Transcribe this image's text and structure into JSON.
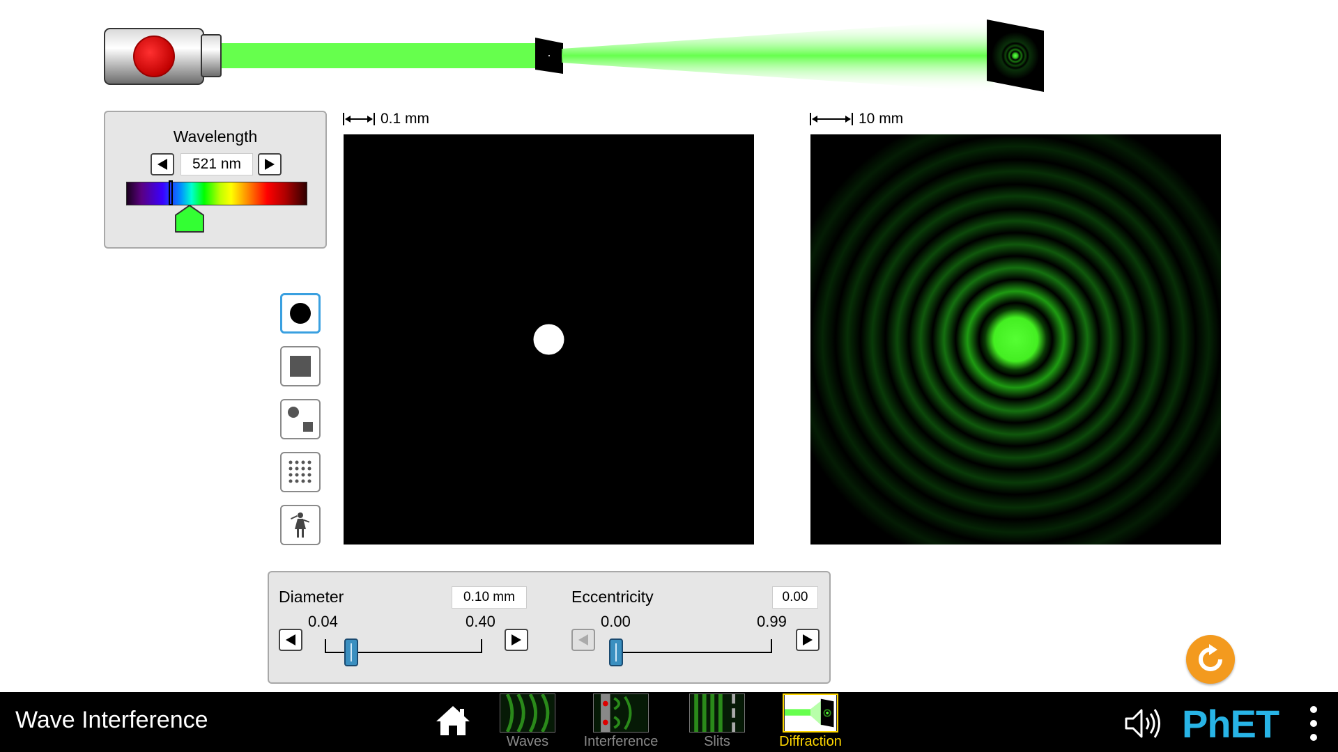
{
  "wavelength": {
    "title": "Wavelength",
    "value": "521 nm",
    "beam_color": "#66ff4d"
  },
  "scales": {
    "aperture": "0.1 mm",
    "pattern": "10 mm"
  },
  "shapes": [
    {
      "name": "circle",
      "selected": true
    },
    {
      "name": "rectangle",
      "selected": false
    },
    {
      "name": "circle-and-square",
      "selected": false
    },
    {
      "name": "lattice",
      "selected": false
    },
    {
      "name": "disorder-figure",
      "selected": false
    }
  ],
  "diameter": {
    "label": "Diameter",
    "value": "0.10 mm",
    "min": "0.04",
    "max": "0.40",
    "fraction": 0.17
  },
  "eccentricity": {
    "label": "Eccentricity",
    "value": "0.00",
    "min": "0.00",
    "max": "0.99",
    "fraction": 0.0
  },
  "navbar": {
    "title": "Wave Interference",
    "tabs": [
      {
        "label": "Waves",
        "active": false
      },
      {
        "label": "Interference",
        "active": false
      },
      {
        "label": "Slits",
        "active": false
      },
      {
        "label": "Diffraction",
        "active": true
      }
    ],
    "logo": "PhET"
  },
  "colors": {
    "accent_tab": "#ffd700",
    "reset": "#f39a1e",
    "slider_thumb": "#3a8fc0",
    "logo": "#28b4e6"
  }
}
